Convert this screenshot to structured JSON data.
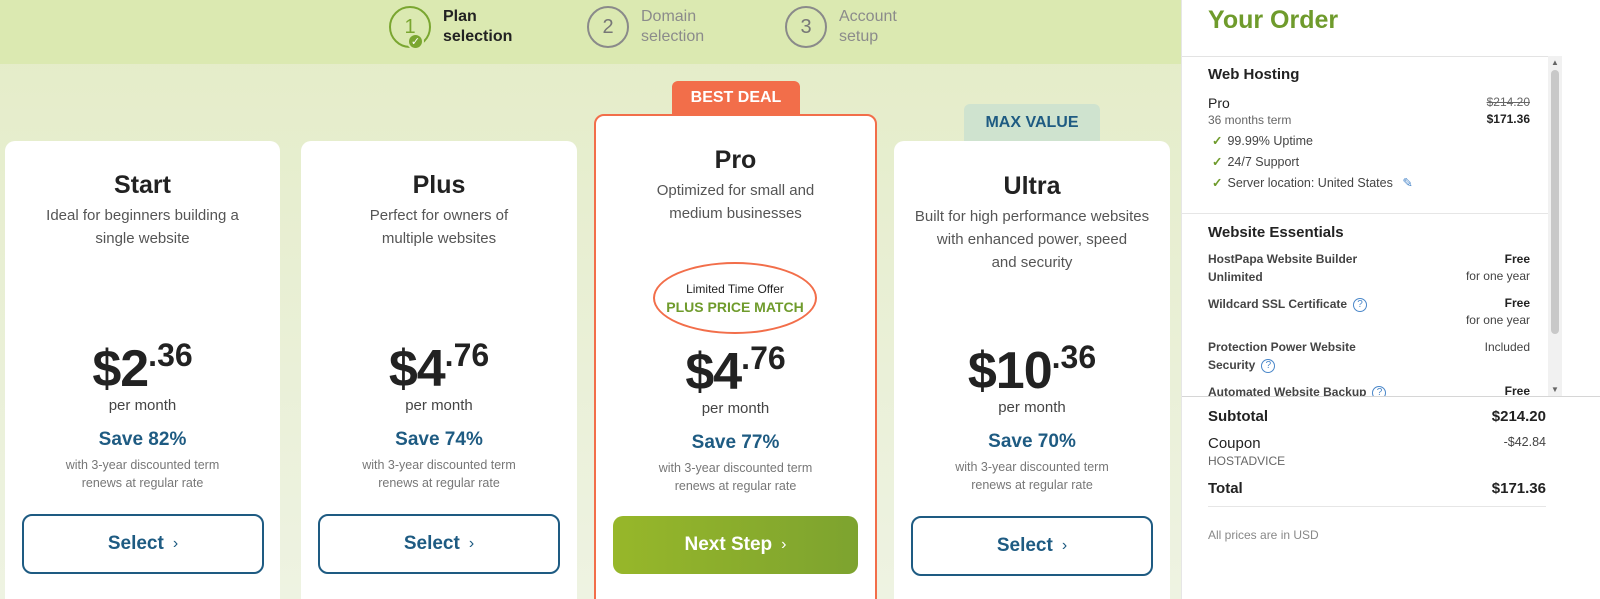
{
  "steps": [
    {
      "number": "1",
      "label_line1": "Plan",
      "label_line2": "selection",
      "state": "active"
    },
    {
      "number": "2",
      "label_line1": "Domain",
      "label_line2": "selection",
      "state": "pending"
    },
    {
      "number": "3",
      "label_line1": "Account",
      "label_line2": "setup",
      "state": "pending"
    }
  ],
  "plans": [
    {
      "name": "Start",
      "desc_line1": "Ideal for beginners building a",
      "desc_line2": "single website",
      "desc_line3": "",
      "price_dollars": "$2",
      "price_cents": ".36",
      "per": "per month",
      "save": "Save 82%",
      "term_line1": "with 3-year discounted term",
      "term_line2": "renews at regular rate",
      "button": "Select"
    },
    {
      "name": "Plus",
      "desc_line1": "Perfect for owners of",
      "desc_line2": "multiple websites",
      "desc_line3": "",
      "price_dollars": "$4",
      "price_cents": ".76",
      "per": "per month",
      "save": "Save 74%",
      "term_line1": "with 3-year discounted term",
      "term_line2": "renews at regular rate",
      "button": "Select"
    },
    {
      "name": "Pro",
      "badge": "BEST DEAL",
      "desc_line1": "Optimized for small and",
      "desc_line2": "medium businesses",
      "desc_line3": "",
      "offer_line1": "Limited Time Offer",
      "offer_line2": "PLUS PRICE MATCH",
      "price_dollars": "$4",
      "price_cents": ".76",
      "per": "per month",
      "save": "Save 77%",
      "term_line1": "with 3-year discounted term",
      "term_line2": "renews at regular rate",
      "button": "Next Step"
    },
    {
      "name": "Ultra",
      "badge": "MAX VALUE",
      "desc_line1": "Built for high performance websites",
      "desc_line2": "with enhanced power, speed",
      "desc_line3": "and security",
      "price_dollars": "$10",
      "price_cents": ".36",
      "per": "per month",
      "save": "Save 70%",
      "term_line1": "with 3-year discounted term",
      "term_line2": "renews at regular rate",
      "button": "Select"
    }
  ],
  "order": {
    "title": "Your Order",
    "hosting": {
      "heading": "Web Hosting",
      "plan": "Pro",
      "term": "36 months term",
      "old_price": "$214.20",
      "price": "$171.36",
      "features": [
        "99.99% Uptime",
        "24/7 Support",
        "Server location: United States"
      ]
    },
    "essentials": {
      "heading": "Website Essentials",
      "items": [
        {
          "name": "HostPapa Website Builder Unlimited",
          "value": "Free",
          "note": "for one year"
        },
        {
          "name": "Wildcard SSL Certificate",
          "value": "Free",
          "note": "for one year"
        },
        {
          "name": "Protection Power Website Security",
          "value": "Included",
          "note": ""
        },
        {
          "name": "Automated Website Backup",
          "value": "Free",
          "note": ""
        }
      ]
    },
    "subtotal_label": "Subtotal",
    "subtotal": "$214.20",
    "coupon_label": "Coupon",
    "coupon_value": "-$42.84",
    "coupon_code": "HOSTADVICE",
    "total_label": "Total",
    "total": "$171.36",
    "currency_note": "All prices are in USD"
  },
  "colors": {
    "accent_green": "#6f9b2c",
    "accent_orange": "#f26e4a",
    "accent_blue": "#1e5b82"
  }
}
